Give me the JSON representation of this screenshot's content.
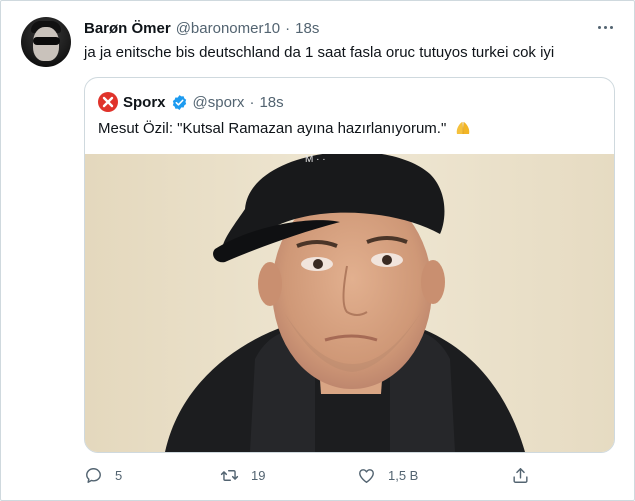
{
  "tweet": {
    "author_name": "Barøn Ömer",
    "author_handle": "@baronomer10",
    "separator": "·",
    "time": "18s",
    "text": "ja ja enitsche bis deutschland da 1 saat fasla oruc tutuyos turkei cok iyi"
  },
  "quoted": {
    "author_name": "Sporx",
    "author_handle": "@sporx",
    "separator": "·",
    "time": "18s",
    "text": "Mesut Özil: \"Kutsal Ramazan ayına hazırlanıyorum.\"",
    "verified_color": "#1d9bf0",
    "avatar_color": "#e0332b"
  },
  "actions": {
    "reply_count": "5",
    "retweet_count": "19",
    "like_count": "1,5 B"
  },
  "icons": {
    "more": "more-horizontal-icon",
    "reply": "reply-icon",
    "retweet": "retweet-icon",
    "like": "heart-icon",
    "share": "share-icon",
    "verified": "verified-badge-icon",
    "emoji": "praying-hands-emoji"
  },
  "colors": {
    "text": "#0f1419",
    "muted": "#536471",
    "border": "#cfd9de",
    "accent": "#1d9bf0"
  }
}
